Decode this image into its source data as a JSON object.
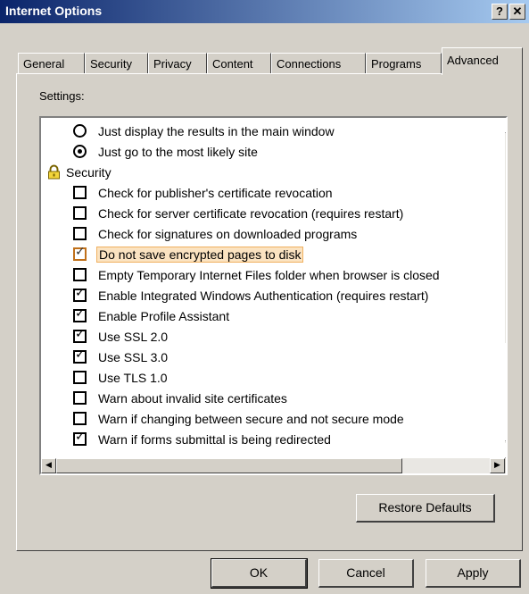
{
  "window": {
    "title": "Internet Options",
    "help_label": "?",
    "close_label": "✕"
  },
  "tabs": [
    {
      "label": "General"
    },
    {
      "label": "Security"
    },
    {
      "label": "Privacy"
    },
    {
      "label": "Content"
    },
    {
      "label": "Connections"
    },
    {
      "label": "Programs"
    },
    {
      "label": "Advanced"
    }
  ],
  "settings_label": "Settings:",
  "items": [
    {
      "type": "radio",
      "checked": false,
      "label": "Just display the results in the main window"
    },
    {
      "type": "radio",
      "checked": true,
      "label": "Just go to the most likely site"
    },
    {
      "type": "group",
      "icon": "lock-icon",
      "label": "Security"
    },
    {
      "type": "checkbox",
      "checked": false,
      "label": "Check for publisher's certificate revocation"
    },
    {
      "type": "checkbox",
      "checked": false,
      "label": "Check for server certificate revocation (requires restart)"
    },
    {
      "type": "checkbox",
      "checked": false,
      "label": "Check for signatures on downloaded programs"
    },
    {
      "type": "checkbox",
      "checked": true,
      "highlight": true,
      "label": "Do not save encrypted pages to disk"
    },
    {
      "type": "checkbox",
      "checked": false,
      "label": "Empty Temporary Internet Files folder when browser is closed"
    },
    {
      "type": "checkbox",
      "checked": true,
      "label": "Enable Integrated Windows Authentication (requires restart)"
    },
    {
      "type": "checkbox",
      "checked": true,
      "label": "Enable Profile Assistant"
    },
    {
      "type": "checkbox",
      "checked": true,
      "label": "Use SSL 2.0"
    },
    {
      "type": "checkbox",
      "checked": true,
      "label": "Use SSL 3.0"
    },
    {
      "type": "checkbox",
      "checked": false,
      "label": "Use TLS 1.0"
    },
    {
      "type": "checkbox",
      "checked": false,
      "label": "Warn about invalid site certificates"
    },
    {
      "type": "checkbox",
      "checked": false,
      "label": "Warn if changing between secure and not secure mode"
    },
    {
      "type": "checkbox",
      "checked": true,
      "label": "Warn if forms submittal is being redirected"
    }
  ],
  "buttons": {
    "restore_defaults": "Restore Defaults",
    "ok": "OK",
    "cancel": "Cancel",
    "apply": "Apply"
  },
  "colors": {
    "title_start": "#0a246a",
    "title_end": "#a6caf0",
    "face": "#d4d0c8",
    "highlight": "#fbe3c1"
  }
}
